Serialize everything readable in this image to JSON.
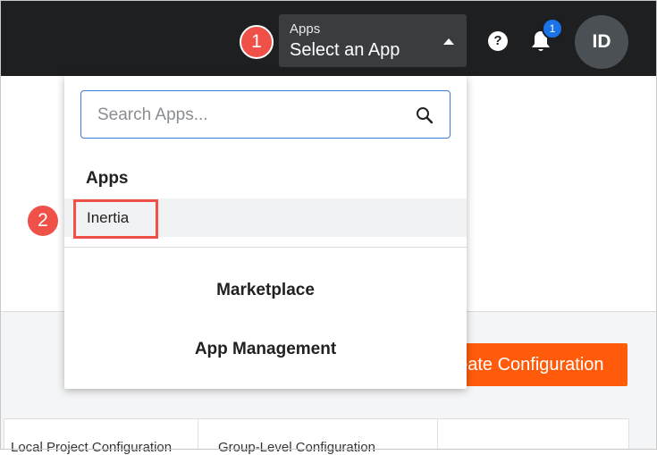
{
  "topbar": {
    "app_selector": {
      "caption": "Apps",
      "value": "Select an App"
    },
    "help_label": "?",
    "notifications": {
      "count": "1"
    },
    "avatar_initials": "ID"
  },
  "steps": {
    "step1": "1",
    "step2": "2"
  },
  "dropdown": {
    "search_placeholder": "Search Apps...",
    "section_title": "Apps",
    "apps": [
      "Inertia"
    ],
    "links": [
      "Marketplace",
      "App Management"
    ]
  },
  "page": {
    "create_button_label": "Create Configuration",
    "table_headers": [
      "Local Project Configuration",
      "Group-Level Configuration"
    ]
  },
  "colors": {
    "topbar": "#1d1f21",
    "accent_orange": "#ff5b0a",
    "step_marker": "#ef5148",
    "badge_blue": "#1a73e8"
  },
  "icons": [
    "chevron-up-icon",
    "help-icon",
    "bell-icon",
    "search-icon"
  ]
}
